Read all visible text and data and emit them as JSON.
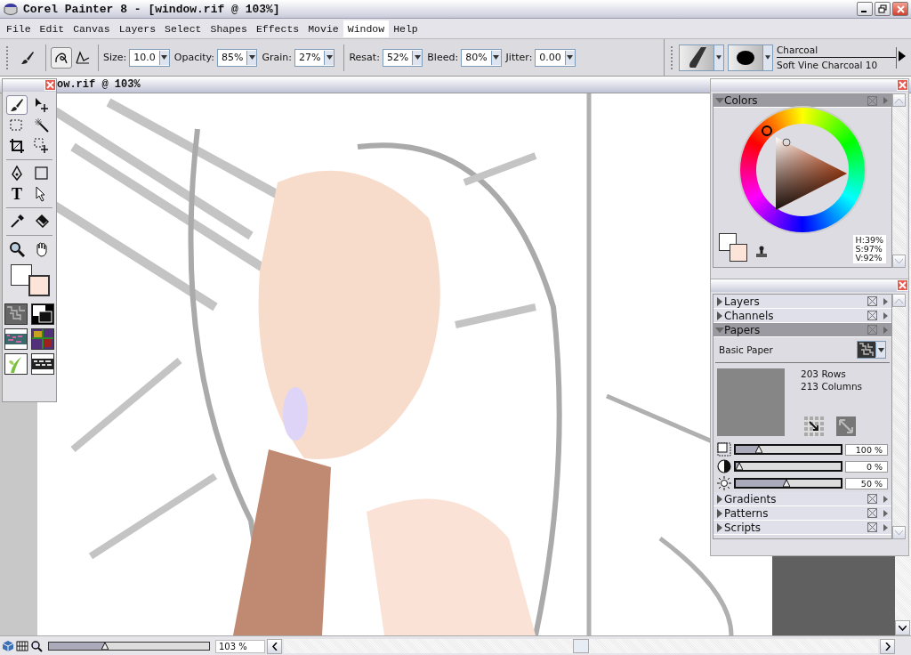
{
  "window": {
    "title": "Corel Painter 8 - [window.rif @ 103%]"
  },
  "menu": [
    {
      "label": "File",
      "selected": false
    },
    {
      "label": "Edit",
      "selected": false
    },
    {
      "label": "Canvas",
      "selected": false
    },
    {
      "label": "Layers",
      "selected": false
    },
    {
      "label": "Select",
      "selected": false
    },
    {
      "label": "Shapes",
      "selected": false
    },
    {
      "label": "Effects",
      "selected": false
    },
    {
      "label": "Movie",
      "selected": false
    },
    {
      "label": "Window",
      "selected": true
    },
    {
      "label": "Help",
      "selected": false
    }
  ],
  "property_bar": {
    "fields": [
      {
        "label": "Size:",
        "value": "10.0"
      },
      {
        "label": "Opacity:",
        "value": "85%"
      },
      {
        "label": "Grain:",
        "value": "27%"
      },
      {
        "label": "Resat:",
        "value": "52%"
      },
      {
        "label": "Bleed:",
        "value": "80%"
      },
      {
        "label": "Jitter:",
        "value": "0.00"
      }
    ]
  },
  "brush_selector": {
    "category": "Charcoal",
    "variant": "Soft Vine Charcoal 10"
  },
  "document": {
    "title": "ow.rif @ 103%"
  },
  "toolbox": {
    "tools": [
      {
        "kind": "brush",
        "selected": true
      },
      {
        "kind": "layer-adjuster",
        "selected": false
      },
      {
        "kind": "rect-select",
        "selected": false
      },
      {
        "kind": "magic-wand",
        "selected": false
      },
      {
        "kind": "crop",
        "selected": false
      },
      {
        "kind": "selection-adjuster",
        "selected": false
      },
      {
        "kind": "pen",
        "selected": false
      },
      {
        "kind": "rectangle",
        "selected": false
      },
      {
        "kind": "text",
        "glyph": "T",
        "selected": false
      },
      {
        "kind": "shape-select",
        "selected": false
      },
      {
        "kind": "dropper",
        "selected": false
      },
      {
        "kind": "bucket",
        "selected": false
      },
      {
        "kind": "magnifier",
        "selected": false
      },
      {
        "kind": "grabber",
        "selected": false
      }
    ]
  },
  "colors_panel": {
    "title": "Colors",
    "expanded": true,
    "readout": [
      "H:39%",
      "S:97%",
      "V:92%"
    ]
  },
  "palette_sections": [
    {
      "title": "Layers",
      "expanded": false
    },
    {
      "title": "Channels",
      "expanded": false
    },
    {
      "title": "Papers",
      "expanded": true,
      "paper_name": "Basic Paper",
      "rows": "203 Rows",
      "columns": "213 Columns",
      "sliders": [
        {
          "kind": "scale",
          "level": 0.22,
          "reading": "100 %"
        },
        {
          "kind": "contrast",
          "level": 0.03,
          "reading": "0 %"
        },
        {
          "kind": "brightness",
          "level": 0.48,
          "reading": "50 %"
        }
      ]
    },
    {
      "title": "Gradients",
      "expanded": false
    },
    {
      "title": "Patterns",
      "expanded": false
    },
    {
      "title": "Scripts",
      "expanded": false
    }
  ],
  "status_bar": {
    "zoom_slider": {
      "level": 0.35
    },
    "zoom": "103 %"
  }
}
